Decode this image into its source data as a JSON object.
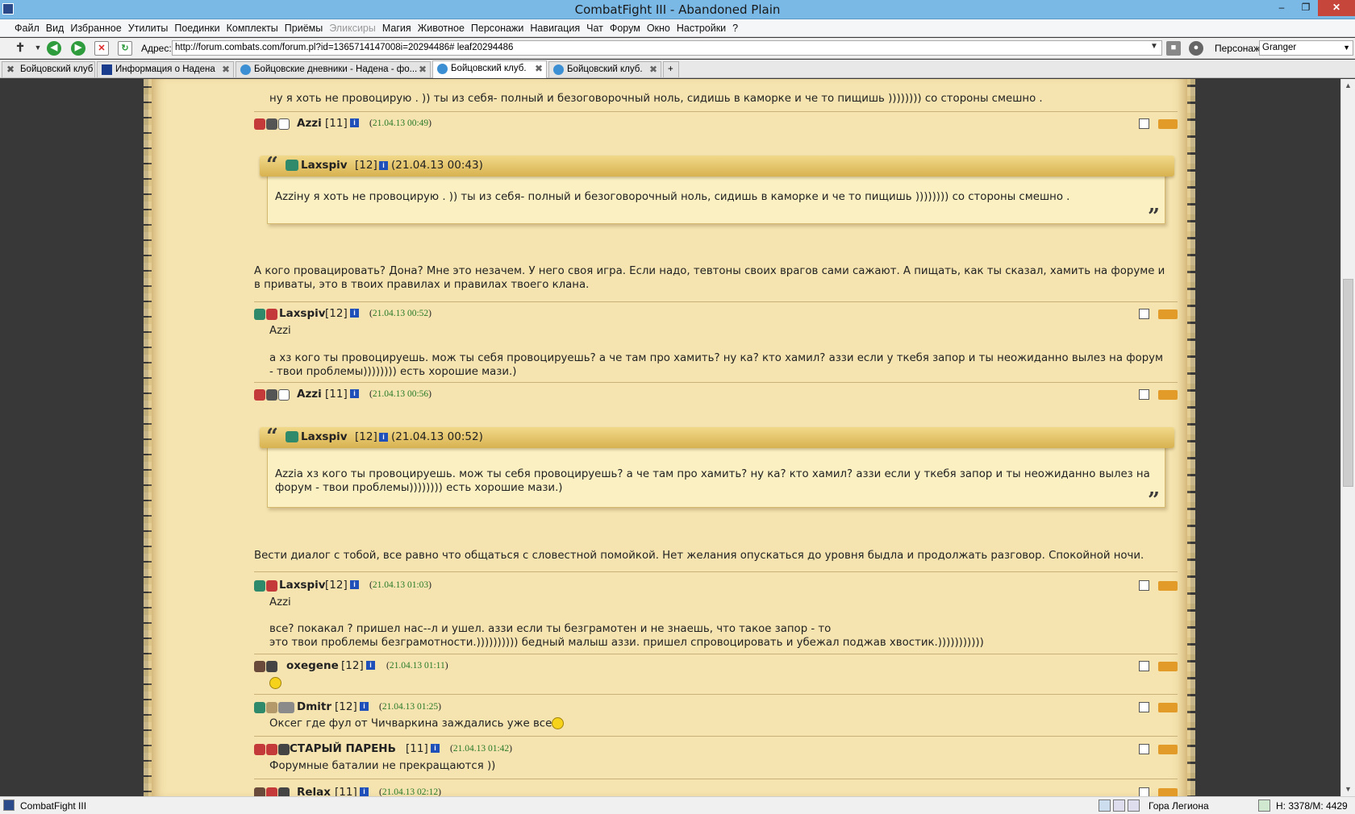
{
  "window": {
    "title": "CombatFight III - Abandoned Plain"
  },
  "menu": [
    "Файл",
    "Вид",
    "Избранное",
    "Утилиты",
    "Поединки",
    "Комплекты",
    "Приёмы",
    "Эликсиры",
    "Магия",
    "Животное",
    "Персонажи",
    "Навигация",
    "Чат",
    "Форум",
    "Окно",
    "Настройки",
    "?"
  ],
  "address": {
    "label": "Адрес:",
    "url": "http://forum.combats.com/forum.pl?id=1365714147008i=20294486# leaf20294486"
  },
  "character": {
    "label": "Персонаж:",
    "value": "Granger"
  },
  "tabs": [
    "Бойцовский клуб",
    "Информация о Надена",
    "Бойцовские дневники - Надена - фо...",
    "Бойцовский клуб.",
    "Бойцовский клуб."
  ],
  "forum": {
    "top_text": "ну я хоть не провоцирую . )) ты из себя- полный и безоговорочный ноль, сидишь в каморке и че то пищишь )))))))) со стороны смешно .",
    "posts": [
      {
        "nick": "Azzi",
        "level": "[11]",
        "date": "21.04.13 00:49",
        "quote": {
          "nick": "Laxspiv",
          "level": "[12]",
          "date": "(21.04.13 00:43)",
          "text": "Azziну я хоть не провоцирую . )) ты из себя- полный и безоговорочный ноль, сидишь в каморке и че то пищишь )))))))) со стороны смешно ."
        },
        "text": "А кого провацировать? Дона? Мне это незачем. У него своя игра. Если надо, тевтоны своих врагов сами сажают. А пищать, как ты сказал, хамить на форуме и в приваты, это в твоих правилах и правилах твоего клана."
      },
      {
        "nick": "Laxspiv",
        "level": "[12]",
        "date": "21.04.13 00:52",
        "addressee": "Azzi",
        "text": "а хз кого ты провоцируешь. мож ты себя провоцируешь? а че там про хамить? ну ка? кто хамил? аззи если у ткебя запор и ты неожиданно вылез на форум - твои проблемы)))))))) есть хорошие мази.)"
      },
      {
        "nick": "Azzi",
        "level": "[11]",
        "date": "21.04.13 00:56",
        "quote": {
          "nick": "Laxspiv",
          "level": "[12]",
          "date": "(21.04.13 00:52)",
          "text": "Azziа хз кого ты провоцируешь. мож ты себя провоцируешь? а че там про хамить? ну ка? кто хамил? аззи если у ткебя запор и ты неожиданно вылез на форум - твои проблемы)))))))) есть хорошие мази.)"
        },
        "text": "Вести диалог с тобой, все равно что общаться с словестной помойкой. Нет желания опускаться до уровня быдла и продолжать разговор. Спокойной ночи."
      },
      {
        "nick": "Laxspiv",
        "level": "[12]",
        "date": "21.04.13 01:03",
        "addressee": "Azzi",
        "text1": "все? покакал ? пришел нас--л и ушел. аззи если ты безграмотен и не знаешь, что такое запор - то",
        "text2": "это твои проблемы безграмотности.)))))))))) бедный малыш аззи. пришел спровоцировать и убежал поджав хвостик.)))))))))))"
      },
      {
        "nick": "oxegene",
        "level": "[12]",
        "date": "21.04.13 01:11",
        "text": ""
      },
      {
        "nick": "Dmitr",
        "level": "[12]",
        "date": "21.04.13 01:25",
        "text": "Оксег где фул от Чичваркина заждались уже все"
      },
      {
        "nick": "СТАРЫЙ ПАРЕНЬ",
        "level": "[11]",
        "date": "21.04.13 01:42",
        "text": "Форумные баталии не прекращаются ))"
      },
      {
        "nick": "Relax",
        "level": "[11]",
        "date": "21.04.13 02:12",
        "text": ""
      }
    ]
  },
  "status": {
    "app": "CombatFight III",
    "location": "Гора Легиона",
    "hp": "H: 3378/M: 4429"
  },
  "colors": {
    "paper": "#f5e4b0",
    "quote_bg": "#faf0c2",
    "date": "#2a7a2a",
    "titlebar": "#7ab8e6"
  }
}
